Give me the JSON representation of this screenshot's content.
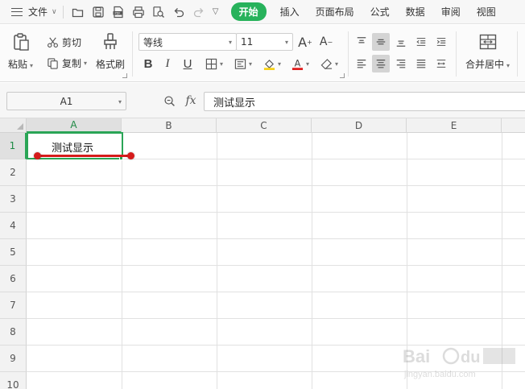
{
  "menubar": {
    "file_label": "文件",
    "tabs": [
      {
        "label": "开始",
        "active": true
      },
      {
        "label": "插入",
        "active": false
      },
      {
        "label": "页面布局",
        "active": false
      },
      {
        "label": "公式",
        "active": false
      },
      {
        "label": "数据",
        "active": false
      },
      {
        "label": "审阅",
        "active": false
      },
      {
        "label": "视图",
        "active": false
      }
    ],
    "quick_icons": [
      "open-icon",
      "save-icon",
      "export-pdf-icon",
      "print-icon",
      "print-preview-icon",
      "undo-icon",
      "redo-icon",
      "more-icon"
    ],
    "accent_color": "#27b25b"
  },
  "ribbon": {
    "paste_label": "粘贴",
    "cut_label": "剪切",
    "copy_label": "复制",
    "format_painter_label": "格式刷",
    "font_name": "等线",
    "font_size": "11",
    "merge_center_label": "合并居中"
  },
  "formula_bar": {
    "cell_ref": "A1",
    "fx_label": "fx",
    "content": "测试显示"
  },
  "grid": {
    "columns": [
      "A",
      "B",
      "C",
      "D",
      "E"
    ],
    "rows": [
      "1",
      "2",
      "3",
      "4",
      "5",
      "6",
      "7",
      "8",
      "9",
      "10"
    ],
    "active_column": "A",
    "active_row": "1",
    "cell_a1": "测试显示",
    "selection_color": "#2aa556",
    "annotation_color": "#d51b1b"
  }
}
